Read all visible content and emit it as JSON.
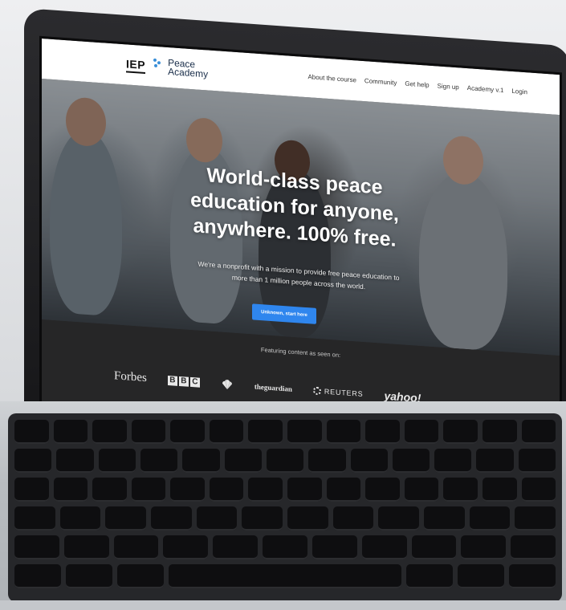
{
  "nav": {
    "logo_primary": "IEP",
    "logo_secondary_line1": "Peace",
    "logo_secondary_line2": "Academy",
    "links": [
      "About the course",
      "Community",
      "Get help",
      "Sign up",
      "Academy v.1",
      "Login"
    ]
  },
  "hero": {
    "title_line1": "World-class peace",
    "title_line2": "education for anyone,",
    "title_line3": "anywhere. 100% free.",
    "subtitle_line1": "We're a nonprofit with a mission to provide free peace education to",
    "subtitle_line2": "more than 1 million people across the world.",
    "cta_label": "Unknown, start here"
  },
  "press": {
    "label": "Featuring content as seen on:",
    "logos": {
      "forbes": "Forbes",
      "bbc": [
        "B",
        "B",
        "C"
      ],
      "guardian": "theguardian",
      "reuters": "REUTERS",
      "yahoo": "yahoo!"
    }
  },
  "colors": {
    "accent": "#2f86ee",
    "nav_bg": "#ffffff",
    "press_bg": "#262627",
    "laptop_frame": "#1b1b1d"
  }
}
